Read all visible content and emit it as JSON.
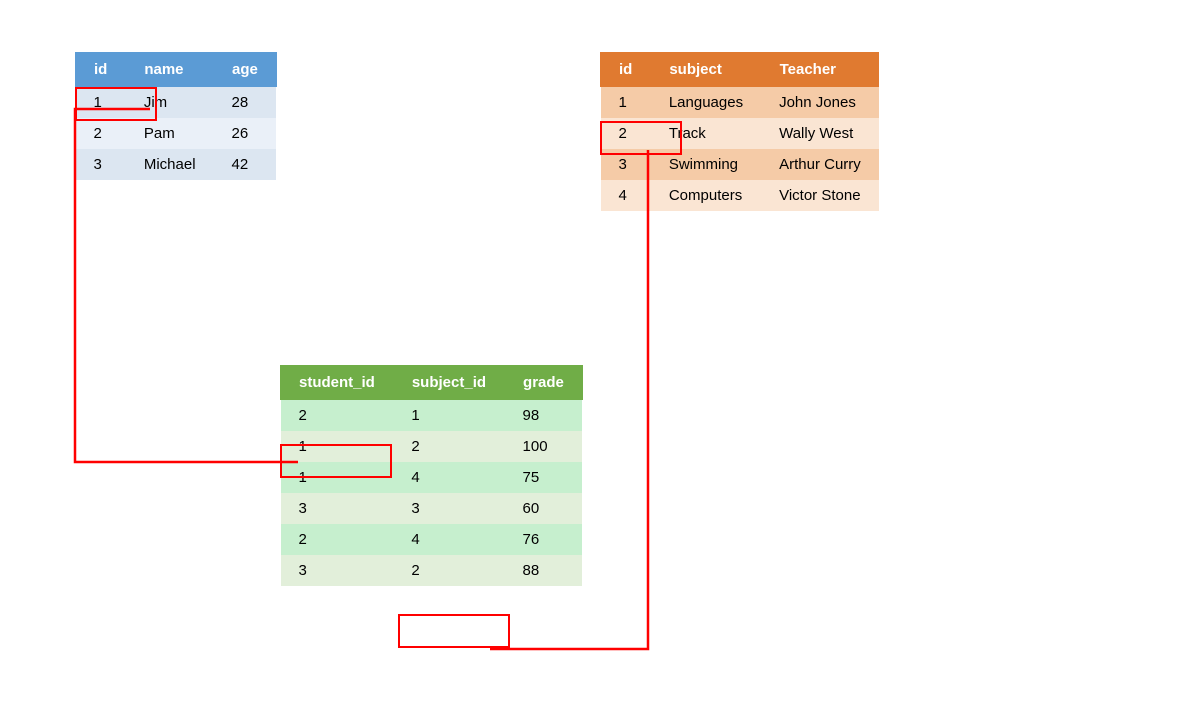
{
  "students": {
    "headers": [
      "id",
      "name",
      "age"
    ],
    "rows": [
      {
        "id": "1",
        "name": "Jim",
        "age": "28"
      },
      {
        "id": "2",
        "name": "Pam",
        "age": "26"
      },
      {
        "id": "3",
        "name": "Michael",
        "age": "42"
      }
    ]
  },
  "subjects": {
    "headers": [
      "id",
      "subject",
      "Teacher"
    ],
    "rows": [
      {
        "id": "1",
        "subject": "Languages",
        "teacher": "John Jones"
      },
      {
        "id": "2",
        "subject": "Track",
        "teacher": "Wally West"
      },
      {
        "id": "3",
        "subject": "Swimming",
        "teacher": "Arthur Curry"
      },
      {
        "id": "4",
        "subject": "Computers",
        "teacher": "Victor Stone"
      }
    ]
  },
  "grades": {
    "headers": [
      "student_id",
      "subject_id",
      "grade"
    ],
    "rows": [
      {
        "student_id": "2",
        "subject_id": "1",
        "grade": "98"
      },
      {
        "student_id": "1",
        "subject_id": "2",
        "grade": "100"
      },
      {
        "student_id": "1",
        "subject_id": "4",
        "grade": "75"
      },
      {
        "student_id": "3",
        "subject_id": "3",
        "grade": "60"
      },
      {
        "student_id": "2",
        "subject_id": "4",
        "grade": "76"
      },
      {
        "student_id": "3",
        "subject_id": "2",
        "grade": "88"
      }
    ]
  }
}
